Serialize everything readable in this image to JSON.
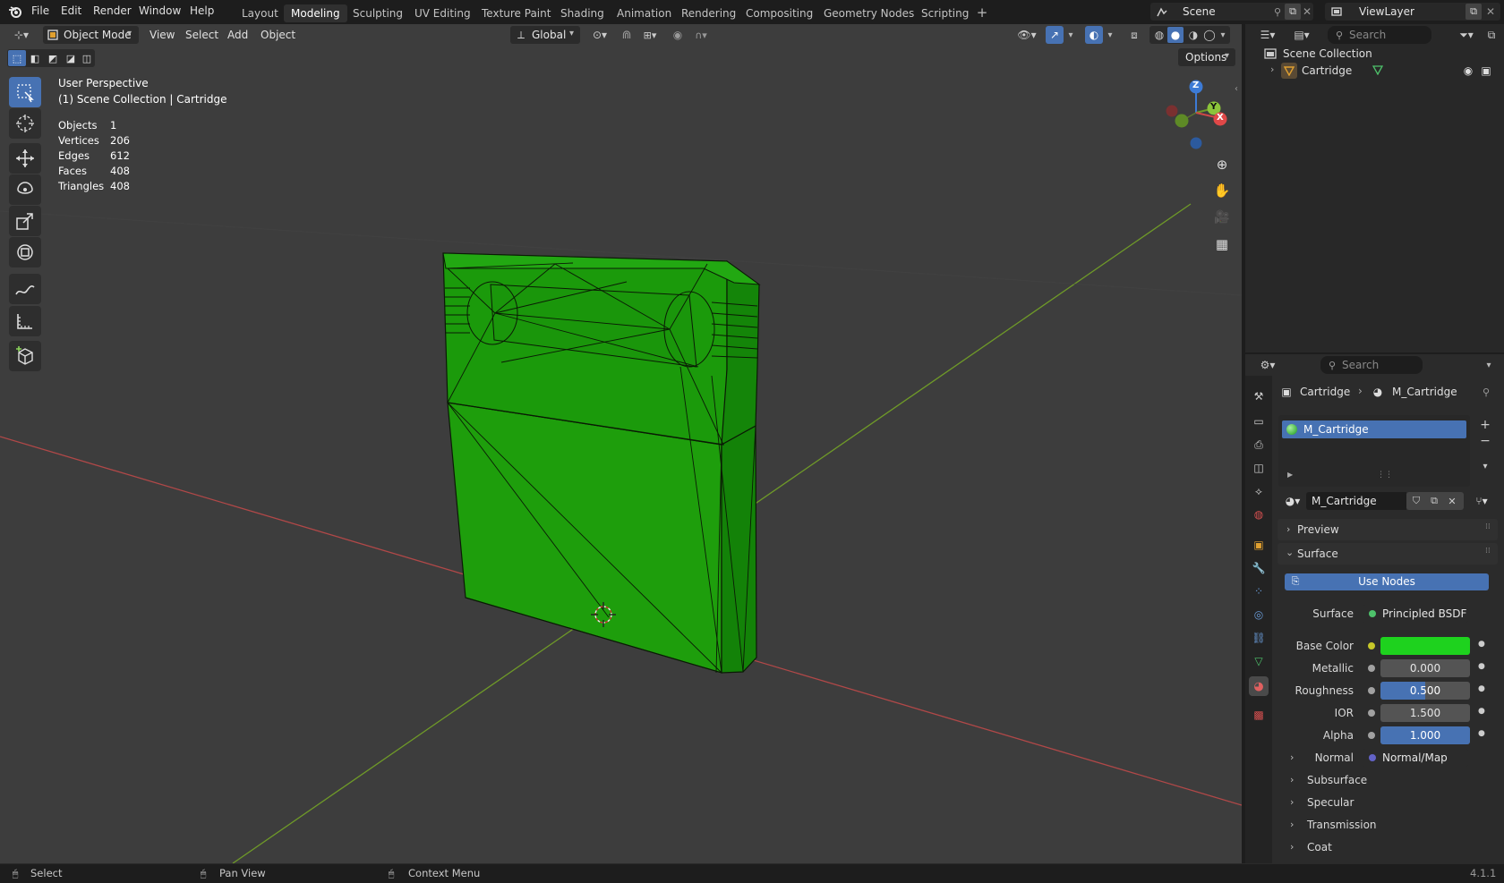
{
  "menu": {
    "items": [
      "File",
      "Edit",
      "Render",
      "Window",
      "Help"
    ]
  },
  "workspaces": {
    "tabs": [
      "Layout",
      "Modeling",
      "Sculpting",
      "UV Editing",
      "Texture Paint",
      "Shading",
      "Animation",
      "Rendering",
      "Compositing",
      "Geometry Nodes",
      "Scripting"
    ],
    "active": "Modeling"
  },
  "scene": {
    "label": "Scene",
    "view_layer": "ViewLayer"
  },
  "viewport": {
    "mode": "Object Mode",
    "menus": [
      "View",
      "Select",
      "Add",
      "Object"
    ],
    "transform_orientation": "Global",
    "options_label": "Options",
    "overlay_title": "User Perspective",
    "overlay_subtitle": "(1) Scene Collection | Cartridge",
    "stats": [
      {
        "label": "Objects",
        "value": "1"
      },
      {
        "label": "Vertices",
        "value": "206"
      },
      {
        "label": "Edges",
        "value": "612"
      },
      {
        "label": "Faces",
        "value": "408"
      },
      {
        "label": "Triangles",
        "value": "408"
      }
    ],
    "gizmo": {
      "x": "X",
      "y": "Y",
      "z": "Z"
    },
    "colors": {
      "background": "#3d3d3d",
      "mesh": "#1a9a0a",
      "x_axis": "#c24545",
      "y_axis": "#6f9a28"
    }
  },
  "outliner": {
    "search_placeholder": "Search",
    "root": "Scene Collection",
    "items": [
      {
        "label": "Cartridge"
      }
    ]
  },
  "properties": {
    "search_placeholder": "Search",
    "breadcrumb": {
      "object": "Cartridge",
      "material": "M_Cartridge"
    },
    "slot": "M_Cartridge",
    "material_name": "M_Cartridge",
    "panels": {
      "preview": "Preview",
      "surface": "Surface"
    },
    "use_nodes": "Use Nodes",
    "surface_shader": {
      "label": "Surface",
      "value": "Principled BSDF"
    },
    "inputs": [
      {
        "label": "Base Color",
        "value": "",
        "color": "#1ed21e"
      },
      {
        "label": "Metallic",
        "value": "0.000"
      },
      {
        "label": "Roughness",
        "value": "0.500",
        "fill": 0.5
      },
      {
        "label": "IOR",
        "value": "1.500"
      },
      {
        "label": "Alpha",
        "value": "1.000",
        "fill": 1.0
      }
    ],
    "normal": {
      "label": "Normal",
      "value": "Normal/Map"
    },
    "subpanels": [
      "Subsurface",
      "Specular",
      "Transmission",
      "Coat"
    ]
  },
  "statusbar": {
    "items": [
      "Select",
      "Pan View",
      "Context Menu"
    ],
    "version": "4.1.1"
  }
}
